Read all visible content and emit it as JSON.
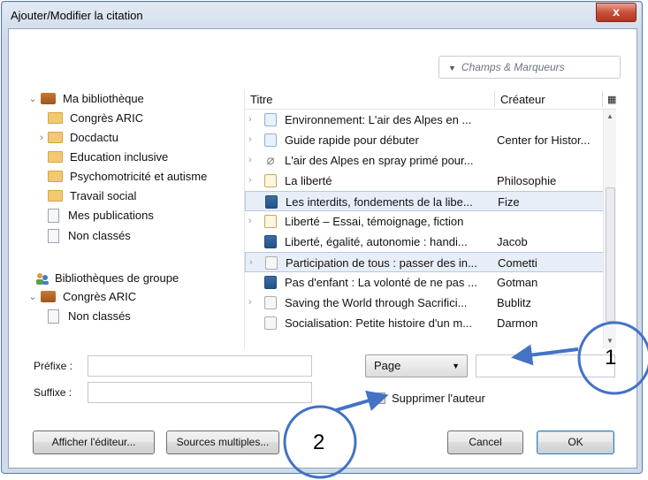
{
  "window": {
    "title": "Ajouter/Modifier la citation",
    "close_glyph": "x"
  },
  "fields_menu": {
    "label": "Champs & Marqueurs"
  },
  "library": {
    "root_label": "Ma bibliothèque",
    "collections": [
      {
        "label": "Congrès ARIC",
        "expandable": false
      },
      {
        "label": "Docdactu",
        "expandable": true
      },
      {
        "label": "Education inclusive",
        "expandable": false
      },
      {
        "label": "Psychomotricité et autisme",
        "expandable": false
      },
      {
        "label": "Travail social",
        "expandable": false
      }
    ],
    "my_publications": "Mes publications",
    "unfiled": "Non classés",
    "group_libraries_label": "Bibliothèques de groupe",
    "group": {
      "label": "Congrès ARIC",
      "unfiled": "Non classés"
    }
  },
  "items_table": {
    "col_title": "Titre",
    "col_creator": "Créateur",
    "rows": [
      {
        "title": "Environnement: L'air des Alpes en ...",
        "creator": "",
        "icon": "webpage-icon",
        "selected": false,
        "expandable": true
      },
      {
        "title": "Guide rapide pour débuter",
        "creator": "Center for Histor...",
        "icon": "webpage-icon",
        "selected": false,
        "expandable": true
      },
      {
        "title": "L'air des Alpes en spray primé pour...",
        "creator": "",
        "icon": "attachment-icon",
        "selected": false,
        "expandable": true
      },
      {
        "title": "La liberté",
        "creator": "Philosophie",
        "icon": "note-icon",
        "selected": false,
        "expandable": true
      },
      {
        "title": "Les interdits, fondements de la libe...",
        "creator": "Fize",
        "icon": "book-icon",
        "selected": true,
        "expandable": false
      },
      {
        "title": "Liberté – Essai, témoignage, fiction",
        "creator": "",
        "icon": "note-icon",
        "selected": false,
        "expandable": true
      },
      {
        "title": "Liberté, égalité, autonomie : handi...",
        "creator": "Jacob",
        "icon": "book-icon",
        "selected": false,
        "expandable": false
      },
      {
        "title": "Participation de tous : passer des in...",
        "creator": "Cometti",
        "icon": "document-icon",
        "selected": true,
        "expandable": true
      },
      {
        "title": "Pas d'enfant : La volonté de ne pas ...",
        "creator": "Gotman",
        "icon": "book-icon",
        "selected": false,
        "expandable": false
      },
      {
        "title": "Saving the World through Sacrifici...",
        "creator": "Bublitz",
        "icon": "document-icon",
        "selected": false,
        "expandable": true
      },
      {
        "title": "Socialisation: Petite histoire d'un m...",
        "creator": "Darmon",
        "icon": "document-icon",
        "selected": false,
        "expandable": false
      }
    ]
  },
  "form": {
    "prefix_label": "Préfixe :",
    "suffix_label": "Suffixe :",
    "prefix_value": "",
    "suffix_value": "",
    "locator_type": "Page",
    "locator_value": "",
    "suppress_author_label": "Supprimer l'auteur",
    "suppress_author_checked": false
  },
  "buttons": {
    "show_editor": "Afficher l'éditeur...",
    "multiple_sources": "Sources multiples...",
    "cancel": "Cancel",
    "ok": "OK"
  },
  "annotations": {
    "callout_1": "1",
    "callout_2": "2",
    "color": "#4472c4"
  }
}
